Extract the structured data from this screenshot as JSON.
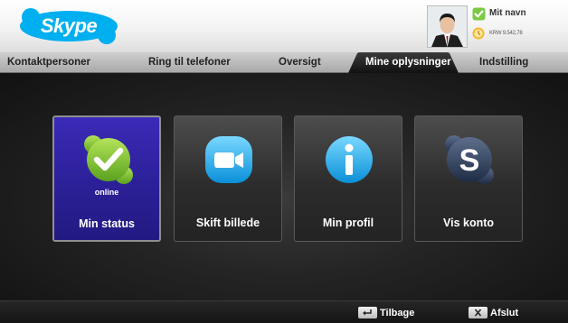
{
  "header": {
    "logo": "Skype",
    "user_name": "Mit navn",
    "credit": "KRW 9.542,78",
    "status_icon": "check-icon",
    "credit_icon": "clock-coin-icon"
  },
  "tabs": [
    {
      "label": "Kontaktpersoner",
      "active": false
    },
    {
      "label": "Ring til telefoner",
      "active": false
    },
    {
      "label": "Oversigt",
      "active": false
    },
    {
      "label": "Mine oplysninger",
      "active": true
    },
    {
      "label": "Indstilling",
      "active": false
    }
  ],
  "tiles": [
    {
      "label": "Min status",
      "icon": "online-status-icon",
      "sublabel": "online",
      "selected": true
    },
    {
      "label": "Skift billede",
      "icon": "video-camera-icon",
      "selected": false
    },
    {
      "label": "Min profil",
      "icon": "info-icon",
      "selected": false
    },
    {
      "label": "Vis konto",
      "icon": "skype-s-icon",
      "selected": false
    }
  ],
  "footer": {
    "back_label": "Tilbage",
    "back_key": "↩",
    "exit_label": "Afslut",
    "exit_key": "✕"
  },
  "colors": {
    "accent_selected": "#2a1f95",
    "skype_blue": "#00aff0",
    "status_green": "#7ac943"
  }
}
